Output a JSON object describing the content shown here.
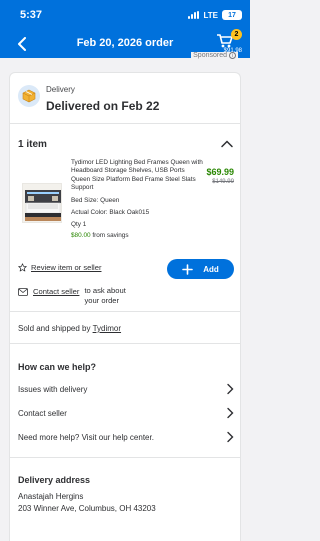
{
  "status_bar": {
    "time": "5:37",
    "network": "LTE",
    "battery": "17"
  },
  "header": {
    "title": "Feb 20, 2026 order",
    "cart_count": "2",
    "cart_total": "$91.98"
  },
  "sponsored_label": "Sponsored",
  "delivery": {
    "label": "Delivery",
    "status": "Delivered on Feb 22"
  },
  "items_section": {
    "count_label": "1 item"
  },
  "product": {
    "name": "Tydimor LED Lighting Bed Frames Queen with Headboard Storage Shelves, USB Ports Queen Size Platform Bed Frame Steel Slats Support",
    "price": "$69.99",
    "was_price": "$149.99",
    "size": "Bed Size: Queen",
    "color": "Actual Color: Black Oak015",
    "qty": "Qty 1",
    "savings_amount": "$80.00",
    "savings_suffix": " from savings"
  },
  "actions": {
    "review_label": "Review item or seller",
    "add_label": "Add",
    "contact_seller_label": "Contact seller",
    "contact_tail": "to ask about your order"
  },
  "seller": {
    "prefix": "Sold and shipped by ",
    "name": "Tydimor"
  },
  "help": {
    "title": "How can we help?",
    "items": [
      {
        "label": "Issues with delivery"
      },
      {
        "label": "Contact seller"
      },
      {
        "label": "Need more help? Visit our help center."
      }
    ]
  },
  "address": {
    "title": "Delivery address",
    "name": "Anastajah Hergins",
    "line": "203 Winner Ave, Columbus, OH 43203"
  },
  "colors": {
    "brand_blue": "#0071dc",
    "price_green": "#2a8703",
    "cart_badge": "#ffc220"
  }
}
